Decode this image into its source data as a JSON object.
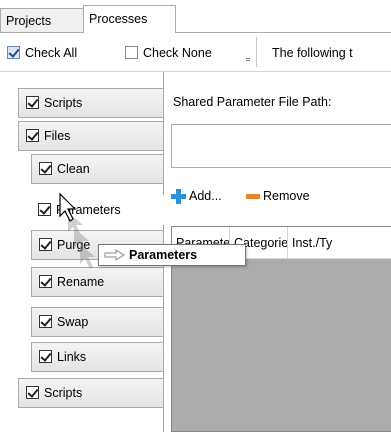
{
  "tabs": {
    "projects": "Projects",
    "processes": "Processes"
  },
  "toolbar": {
    "check_all": "Check All",
    "check_none": "Check None",
    "info_text": "The following t"
  },
  "nav": {
    "items": [
      {
        "label": "Scripts",
        "checked": true
      },
      {
        "label": "Files",
        "checked": true
      },
      {
        "label": "Clean",
        "checked": true
      },
      {
        "label": "Parameters",
        "checked": true
      },
      {
        "label": "Purge",
        "checked": true
      },
      {
        "label": "Rename",
        "checked": true
      },
      {
        "label": "Swap",
        "checked": true
      },
      {
        "label": "Links",
        "checked": true
      },
      {
        "label": "Scripts",
        "checked": true
      }
    ]
  },
  "main": {
    "path_label": "Shared Parameter File Path:",
    "path_value": "",
    "add_label": "Add...",
    "remove_label": "Remove",
    "columns": [
      "Paramete",
      "Categorie",
      "Inst./Ty"
    ]
  },
  "drag": {
    "tooltip": "Parameters"
  },
  "colors": {
    "add_icon": "#2f8fd8",
    "remove_icon": "#e8822b",
    "grid_bg": "#ababab"
  }
}
